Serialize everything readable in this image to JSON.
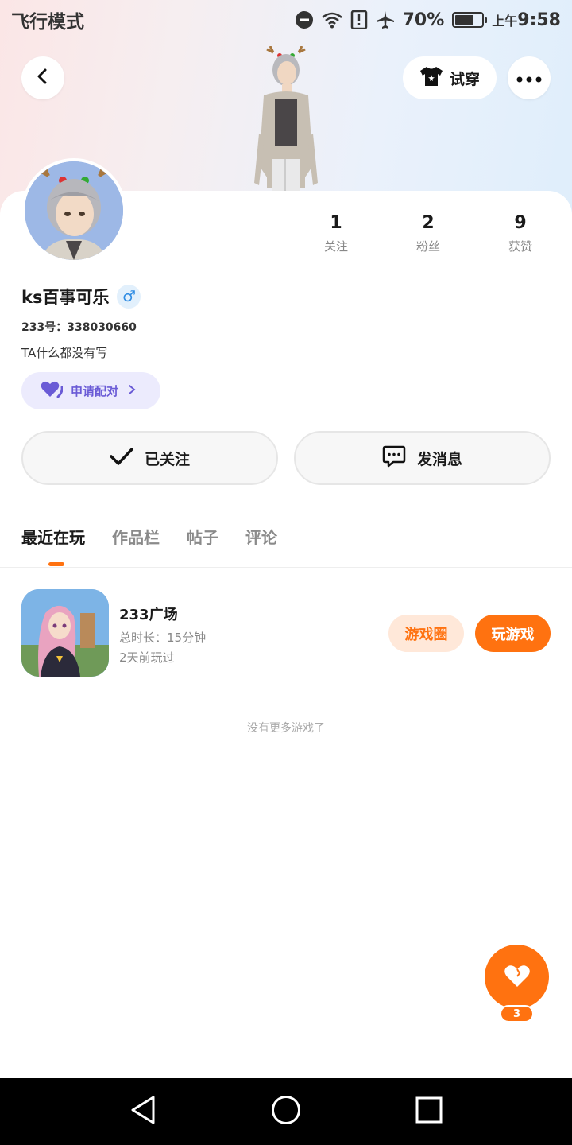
{
  "status_bar": {
    "mode_text": "飞行模式",
    "battery_percent": "70%",
    "battery_level": 0.7,
    "time_prefix": "上午",
    "time": "9:58",
    "icons": [
      "dnd-icon",
      "wifi-icon",
      "alert-icon",
      "airplane-icon",
      "battery-icon"
    ]
  },
  "header": {
    "tryon_label": "试穿",
    "icons": [
      "back-icon",
      "shirt-icon",
      "more-icon"
    ]
  },
  "profile": {
    "stats": [
      {
        "value": "1",
        "label": "关注"
      },
      {
        "value": "2",
        "label": "粉丝"
      },
      {
        "value": "9",
        "label": "获赞"
      }
    ],
    "username": "ks百事可乐",
    "gender_symbol": "♂",
    "uid": "233号：338030660",
    "bio": "TA什么都没有写",
    "pair_label": "申请配对"
  },
  "actions": {
    "follow_label": "已关注",
    "message_label": "发消息"
  },
  "tabs": [
    {
      "label": "最近在玩",
      "active": true
    },
    {
      "label": "作品栏",
      "active": false
    },
    {
      "label": "帖子",
      "active": false
    },
    {
      "label": "评论",
      "active": false
    }
  ],
  "games": [
    {
      "name": "233广场",
      "duration": "总时长：15分钟",
      "last_played": "2天前玩过",
      "circle_label": "游戏圈",
      "play_label": "玩游戏"
    }
  ],
  "empty_text": "没有更多游戏了",
  "fab": {
    "badge_count": "3",
    "icon": "heart-icon"
  },
  "colors": {
    "accent": "#ff7210",
    "pair_purple": "#6a5bd6",
    "gender_blue": "#2f8ce3"
  }
}
